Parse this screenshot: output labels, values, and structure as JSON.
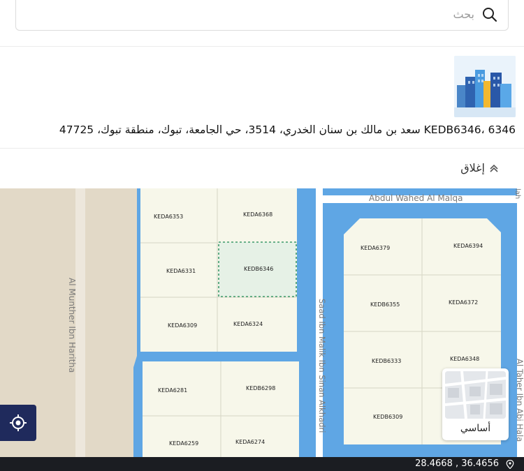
{
  "search": {
    "placeholder": "بحث"
  },
  "info": {
    "address": "KEDB6346، 6346 سعد بن مالك بن سنان الخدري، 3514، حي الجامعة، تبوك، منطقة تبوك، 47725"
  },
  "close": {
    "label": "إغلاق"
  },
  "map": {
    "parcels": [
      "KEDA6353",
      "KEDA6368",
      "KEDA6331",
      "KEDB6346",
      "KEDA6309",
      "KEDA6324",
      "KEDA6281",
      "KEDB6298",
      "KEDA6259",
      "KEDA6274",
      "KEDA6379",
      "KEDA6394",
      "KEDB6355",
      "KEDA6372",
      "KEDB6333",
      "KEDA6348",
      "KEDB6309"
    ],
    "selected_parcel": "KEDB6346",
    "streets": {
      "top": "Abdul Wahed Al Malqa",
      "left": "Al Munther Ibn Haritha",
      "middle": "Saad Ibn Malik Ibn Sinan Alkhadri",
      "right": "Al Taher Ibn Abi Hala",
      "corner": "lah"
    },
    "colors": {
      "water": "#5fa6e4",
      "block": "#f7f7ea",
      "selected": "#e6f1e6",
      "sand": "#e2d9c7"
    }
  },
  "layer": {
    "label": "أساسي"
  },
  "coordinates": {
    "text": "28.4668 , 36.4656"
  }
}
